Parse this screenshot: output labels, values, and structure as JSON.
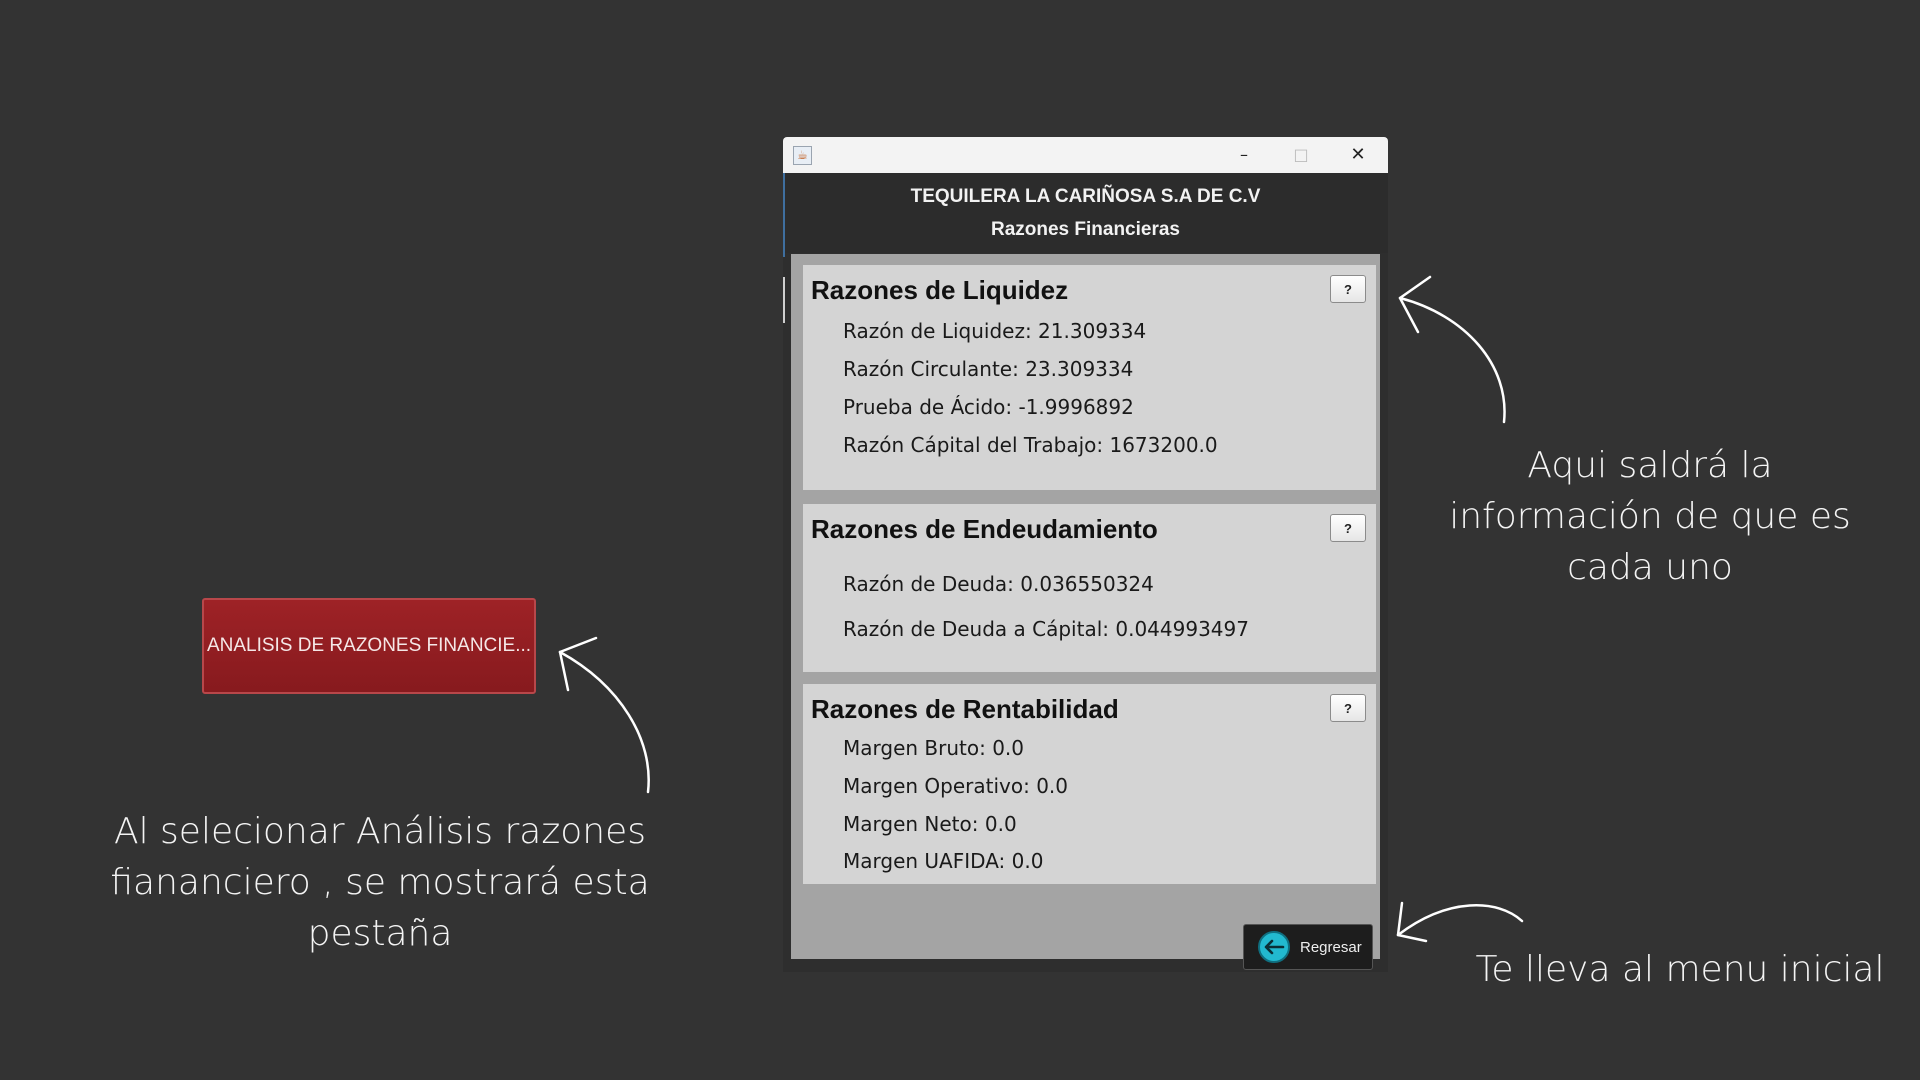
{
  "launch_button": {
    "label": "ANALISIS DE RAZONES FINANCIE..."
  },
  "annotations": {
    "left": [
      "Al selecionar  Análisis razones",
      "fiananciero , se mostrará esta",
      "pestaña"
    ],
    "right": [
      "Aqui saldrá la",
      "información de que es",
      "cada uno"
    ],
    "bottom": "Te lleva al menu inicial"
  },
  "window": {
    "title": "",
    "controls": {
      "minimize": "–",
      "maximize": "□",
      "close": "✕"
    },
    "company": "TEQUILERA LA CARIÑOSA S.A DE C.V",
    "subtitle": "Razones Financieras",
    "panels": {
      "liquidez": {
        "title": "Razones de Liquidez",
        "help": "?",
        "rows": [
          "Razón de Liquidez: 21.309334",
          "Razón Circulante: 23.309334",
          "Prueba de Ácido: -1.9996892",
          "Razón Cápital del Trabajo: 1673200.0"
        ]
      },
      "endeudamiento": {
        "title": "Razones de Endeudamiento",
        "help": "?",
        "rows": [
          "Razón de Deuda: 0.036550324",
          "Razón de Deuda a Cápital: 0.044993497"
        ]
      },
      "rentabilidad": {
        "title": "Razones de Rentabilidad",
        "help": "?",
        "rows": [
          "Margen Bruto: 0.0",
          "Margen Operativo: 0.0",
          "Margen Neto: 0.0",
          "Margen UAFIDA: 0.0"
        ]
      }
    },
    "back_button": {
      "label": "Regresar",
      "icon": "arrow-left-circle-icon"
    }
  },
  "colors": {
    "background": "#333333",
    "launch_button": "#9e2226",
    "panel": "#d4d4d4",
    "body_area": "#a4a4a4",
    "back_icon": "#22b9cf"
  }
}
